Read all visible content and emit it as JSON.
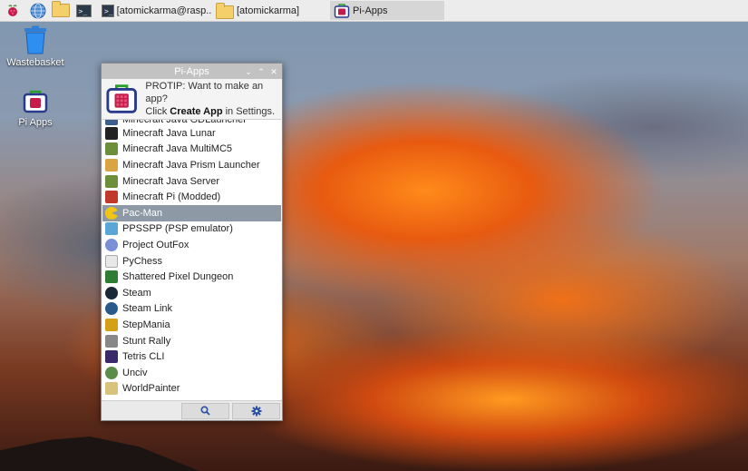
{
  "taskbar": {
    "launchers": [
      {
        "icon": "raspberry-pi-icon"
      },
      {
        "icon": "web-browser-icon"
      },
      {
        "icon": "file-manager-icon"
      },
      {
        "icon": "terminal-icon"
      }
    ],
    "tasks": [
      {
        "icon": "terminal-icon",
        "label": "[atomickarma@rasp...",
        "active": false
      },
      {
        "icon": "folder-icon",
        "label": "[atomickarma]",
        "active": false
      },
      {
        "icon": "pi-apps-icon",
        "label": "Pi-Apps",
        "active": true
      }
    ]
  },
  "desktop": {
    "icons": [
      {
        "icon": "trash-icon",
        "label": "Wastebasket"
      },
      {
        "icon": "pi-apps-icon",
        "label": "Pi Apps"
      }
    ]
  },
  "window": {
    "title": "Pi-Apps",
    "controls": {
      "minimize": "⌄",
      "maximize": "⌃",
      "close": "✕"
    },
    "protip": {
      "line1": "PROTIP: Want to make an app?",
      "line2_prefix": "Click ",
      "line2_bold": "Create App",
      "line2_suffix": " in Settings."
    },
    "apps": [
      {
        "name": "Minecraft Java GDLauncher",
        "icon": "gdlauncher-icon",
        "color": "#3b5e8c",
        "partial": true
      },
      {
        "name": "Minecraft Java Lunar",
        "icon": "lunar-icon",
        "color": "#222222"
      },
      {
        "name": "Minecraft Java MultiMC5",
        "icon": "minecraft-block-icon",
        "color": "#6b8f3a"
      },
      {
        "name": "Minecraft Java Prism Launcher",
        "icon": "prism-icon",
        "color": "#d9a441"
      },
      {
        "name": "Minecraft Java Server",
        "icon": "minecraft-block-icon",
        "color": "#6b8f3a"
      },
      {
        "name": "Minecraft Pi (Modded)",
        "icon": "minecraft-pi-icon",
        "color": "#c0392b"
      },
      {
        "name": "Pac-Man",
        "icon": "pacman-icon",
        "color": "#f2c515",
        "selected": true
      },
      {
        "name": "PPSSPP (PSP emulator)",
        "icon": "ppsspp-icon",
        "color": "#5aa6d6"
      },
      {
        "name": "Project OutFox",
        "icon": "outfox-icon",
        "color": "#7a8fd6"
      },
      {
        "name": "PyChess",
        "icon": "chess-icon",
        "color": "#e8e8e8"
      },
      {
        "name": "Shattered Pixel Dungeon",
        "icon": "sword-icon",
        "color": "#2e7d32"
      },
      {
        "name": "Steam",
        "icon": "steam-icon",
        "color": "#1b2838"
      },
      {
        "name": "Steam Link",
        "icon": "steam-link-icon",
        "color": "#2a5a8a"
      },
      {
        "name": "StepMania",
        "icon": "stepmania-icon",
        "color": "#d4a017"
      },
      {
        "name": "Stunt Rally",
        "icon": "stunt-rally-icon",
        "color": "#888888"
      },
      {
        "name": "Tetris CLI",
        "icon": "tetris-icon",
        "color": "#3a2a6a"
      },
      {
        "name": "Unciv",
        "icon": "unciv-icon",
        "color": "#5b8c4a"
      },
      {
        "name": "WorldPainter",
        "icon": "worldpainter-icon",
        "color": "#d9c27a"
      }
    ],
    "bottom_buttons": [
      {
        "icon": "search-icon"
      },
      {
        "icon": "gear-icon"
      }
    ],
    "accent": "#8d9aa6"
  }
}
